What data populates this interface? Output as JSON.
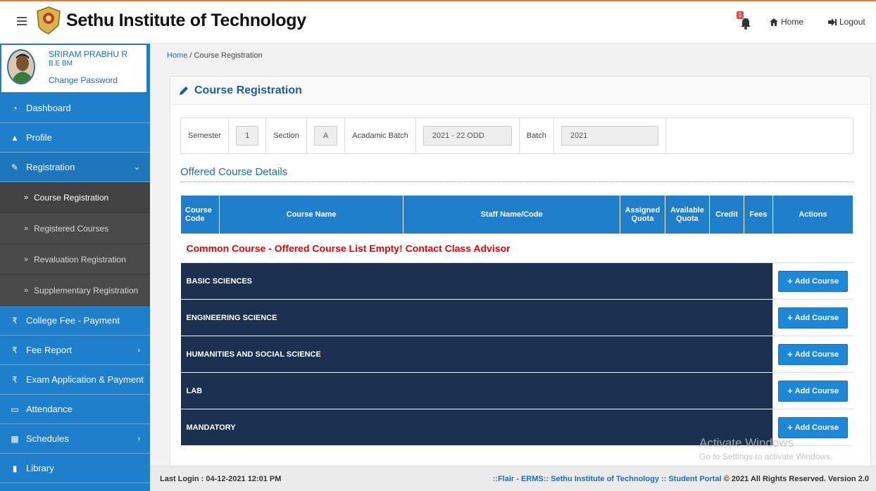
{
  "header": {
    "title": "Sethu Institute of Technology",
    "notification_count": "1",
    "home_label": "Home",
    "logout_label": "Logout"
  },
  "user": {
    "name": "SRIRAM PRABHU R",
    "dept": "B.E BM",
    "change_password": "Change Password"
  },
  "sidebar": {
    "items": [
      {
        "label": "Dashboard",
        "icon": "dashboard-icon"
      },
      {
        "label": "Profile",
        "icon": "user-icon"
      },
      {
        "label": "Registration",
        "icon": "edit-icon"
      },
      {
        "label": "College Fee - Payment",
        "icon": "rupee-icon"
      },
      {
        "label": "Fee Report",
        "icon": "rupee-icon"
      },
      {
        "label": "Exam Application & Payment",
        "icon": "rupee-icon"
      },
      {
        "label": "Attendance",
        "icon": "calendar-icon"
      },
      {
        "label": "Schedules",
        "icon": "table-icon"
      },
      {
        "label": "Library",
        "icon": "book-icon"
      }
    ],
    "registration_sub": [
      {
        "label": "Course Registration"
      },
      {
        "label": "Registered Courses"
      },
      {
        "label": "Revaluation Registration"
      },
      {
        "label": "Supplementary Registration"
      }
    ]
  },
  "breadcrumb": {
    "home": "Home",
    "current": " / Course Registration"
  },
  "page": {
    "title": "Course Registration"
  },
  "filters": {
    "semester_label": "Semester",
    "semester_value": "1",
    "section_label": "Section",
    "section_value": "A",
    "academic_batch_label": "Acadamic Batch",
    "academic_batch_value": "2021 - 22 ODD",
    "batch_label": "Batch",
    "batch_value": "2021"
  },
  "offered": {
    "title": "Offered Course Details",
    "columns": [
      "Course Code",
      "Course Name",
      "Staff Name/Code",
      "Assigned Quota",
      "Available Quota",
      "Credit",
      "Fees",
      "Actions"
    ],
    "message": "Common Course - Offered Course List Empty! Contact Class Advisor",
    "categories": [
      "BASIC SCIENCES",
      "ENGINEERING SCIENCE",
      "HUMANITIES AND SOCIAL SCIENCE",
      "LAB",
      "MANDATORY"
    ],
    "add_label": "Add Course"
  },
  "footer": {
    "last_login": "Last Login : 04-12-2021 12:01 PM",
    "copyright_link": "::Flair - ERMS:: Sethu Institute of Technology :: Student Portal",
    "copyright_rest": " © 2021 All Rights Reserved. Version 2.0"
  },
  "watermark": {
    "line1": "Activate Windows",
    "line2": "Go to Settings to activate Windows."
  }
}
